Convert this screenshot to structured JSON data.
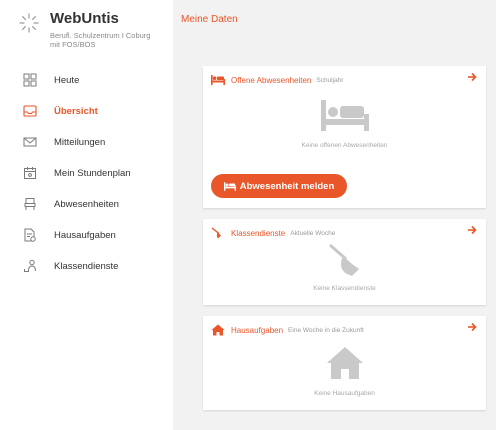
{
  "brand": {
    "name": "WebUntis",
    "school_line1": "Berufl. Schulzentrum I Coburg",
    "school_line2": "mit FOS/BOS"
  },
  "nav": [
    {
      "label": "Heute",
      "icon": "grid-icon"
    },
    {
      "label": "Übersicht",
      "icon": "inbox-icon",
      "active": true
    },
    {
      "label": "Mitteilungen",
      "icon": "envelope-icon"
    },
    {
      "label": "Mein Stundenplan",
      "icon": "calendar-icon"
    },
    {
      "label": "Abwesenheiten",
      "icon": "bed-icon"
    },
    {
      "label": "Hausaufgaben",
      "icon": "homework-icon"
    },
    {
      "label": "Klassendienste",
      "icon": "person-icon"
    }
  ],
  "main": {
    "title": "Meine Daten",
    "cards": {
      "absences": {
        "title": "Offene Abwesenheiten",
        "subtitle": "Schuljahr",
        "empty": "Keine offenen Abwesenheiten",
        "button": "Abwesenheit melden"
      },
      "duties": {
        "title": "Klassendienste",
        "subtitle": "Aktuelle Woche",
        "empty": "Keine Klassendienste"
      },
      "homework": {
        "title": "Hausaufgaben",
        "subtitle": "Eine Woche in die Zukunft",
        "empty": "Keine Hausaufgaben"
      }
    }
  },
  "colors": {
    "accent": "#e8562a",
    "icon_gray": "#c9c9c9",
    "background": "#f2f2f2"
  }
}
